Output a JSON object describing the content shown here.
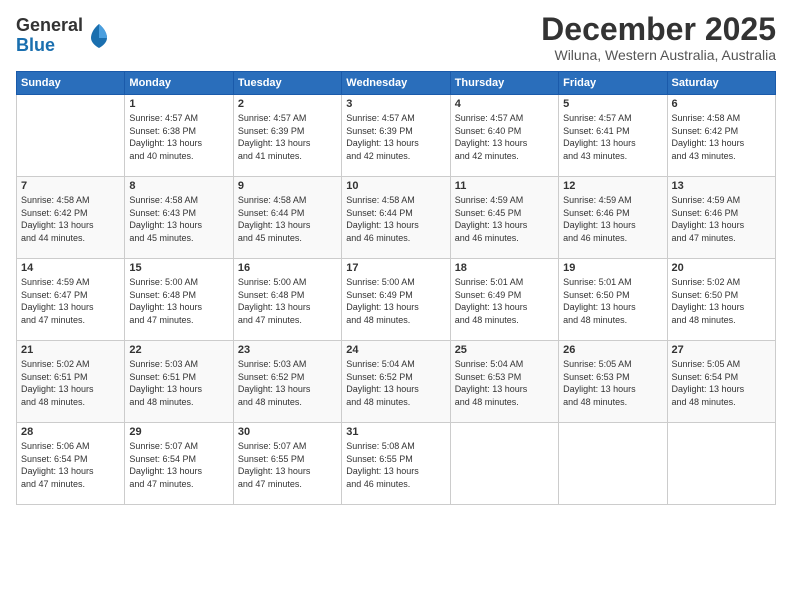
{
  "logo": {
    "general": "General",
    "blue": "Blue"
  },
  "title": "December 2025",
  "subtitle": "Wiluna, Western Australia, Australia",
  "days_header": [
    "Sunday",
    "Monday",
    "Tuesday",
    "Wednesday",
    "Thursday",
    "Friday",
    "Saturday"
  ],
  "weeks": [
    [
      {
        "num": "",
        "info": ""
      },
      {
        "num": "1",
        "info": "Sunrise: 4:57 AM\nSunset: 6:38 PM\nDaylight: 13 hours\nand 40 minutes."
      },
      {
        "num": "2",
        "info": "Sunrise: 4:57 AM\nSunset: 6:39 PM\nDaylight: 13 hours\nand 41 minutes."
      },
      {
        "num": "3",
        "info": "Sunrise: 4:57 AM\nSunset: 6:39 PM\nDaylight: 13 hours\nand 42 minutes."
      },
      {
        "num": "4",
        "info": "Sunrise: 4:57 AM\nSunset: 6:40 PM\nDaylight: 13 hours\nand 42 minutes."
      },
      {
        "num": "5",
        "info": "Sunrise: 4:57 AM\nSunset: 6:41 PM\nDaylight: 13 hours\nand 43 minutes."
      },
      {
        "num": "6",
        "info": "Sunrise: 4:58 AM\nSunset: 6:42 PM\nDaylight: 13 hours\nand 43 minutes."
      }
    ],
    [
      {
        "num": "7",
        "info": "Sunrise: 4:58 AM\nSunset: 6:42 PM\nDaylight: 13 hours\nand 44 minutes."
      },
      {
        "num": "8",
        "info": "Sunrise: 4:58 AM\nSunset: 6:43 PM\nDaylight: 13 hours\nand 45 minutes."
      },
      {
        "num": "9",
        "info": "Sunrise: 4:58 AM\nSunset: 6:44 PM\nDaylight: 13 hours\nand 45 minutes."
      },
      {
        "num": "10",
        "info": "Sunrise: 4:58 AM\nSunset: 6:44 PM\nDaylight: 13 hours\nand 46 minutes."
      },
      {
        "num": "11",
        "info": "Sunrise: 4:59 AM\nSunset: 6:45 PM\nDaylight: 13 hours\nand 46 minutes."
      },
      {
        "num": "12",
        "info": "Sunrise: 4:59 AM\nSunset: 6:46 PM\nDaylight: 13 hours\nand 46 minutes."
      },
      {
        "num": "13",
        "info": "Sunrise: 4:59 AM\nSunset: 6:46 PM\nDaylight: 13 hours\nand 47 minutes."
      }
    ],
    [
      {
        "num": "14",
        "info": "Sunrise: 4:59 AM\nSunset: 6:47 PM\nDaylight: 13 hours\nand 47 minutes."
      },
      {
        "num": "15",
        "info": "Sunrise: 5:00 AM\nSunset: 6:48 PM\nDaylight: 13 hours\nand 47 minutes."
      },
      {
        "num": "16",
        "info": "Sunrise: 5:00 AM\nSunset: 6:48 PM\nDaylight: 13 hours\nand 47 minutes."
      },
      {
        "num": "17",
        "info": "Sunrise: 5:00 AM\nSunset: 6:49 PM\nDaylight: 13 hours\nand 48 minutes."
      },
      {
        "num": "18",
        "info": "Sunrise: 5:01 AM\nSunset: 6:49 PM\nDaylight: 13 hours\nand 48 minutes."
      },
      {
        "num": "19",
        "info": "Sunrise: 5:01 AM\nSunset: 6:50 PM\nDaylight: 13 hours\nand 48 minutes."
      },
      {
        "num": "20",
        "info": "Sunrise: 5:02 AM\nSunset: 6:50 PM\nDaylight: 13 hours\nand 48 minutes."
      }
    ],
    [
      {
        "num": "21",
        "info": "Sunrise: 5:02 AM\nSunset: 6:51 PM\nDaylight: 13 hours\nand 48 minutes."
      },
      {
        "num": "22",
        "info": "Sunrise: 5:03 AM\nSunset: 6:51 PM\nDaylight: 13 hours\nand 48 minutes."
      },
      {
        "num": "23",
        "info": "Sunrise: 5:03 AM\nSunset: 6:52 PM\nDaylight: 13 hours\nand 48 minutes."
      },
      {
        "num": "24",
        "info": "Sunrise: 5:04 AM\nSunset: 6:52 PM\nDaylight: 13 hours\nand 48 minutes."
      },
      {
        "num": "25",
        "info": "Sunrise: 5:04 AM\nSunset: 6:53 PM\nDaylight: 13 hours\nand 48 minutes."
      },
      {
        "num": "26",
        "info": "Sunrise: 5:05 AM\nSunset: 6:53 PM\nDaylight: 13 hours\nand 48 minutes."
      },
      {
        "num": "27",
        "info": "Sunrise: 5:05 AM\nSunset: 6:54 PM\nDaylight: 13 hours\nand 48 minutes."
      }
    ],
    [
      {
        "num": "28",
        "info": "Sunrise: 5:06 AM\nSunset: 6:54 PM\nDaylight: 13 hours\nand 47 minutes."
      },
      {
        "num": "29",
        "info": "Sunrise: 5:07 AM\nSunset: 6:54 PM\nDaylight: 13 hours\nand 47 minutes."
      },
      {
        "num": "30",
        "info": "Sunrise: 5:07 AM\nSunset: 6:55 PM\nDaylight: 13 hours\nand 47 minutes."
      },
      {
        "num": "31",
        "info": "Sunrise: 5:08 AM\nSunset: 6:55 PM\nDaylight: 13 hours\nand 46 minutes."
      },
      {
        "num": "",
        "info": ""
      },
      {
        "num": "",
        "info": ""
      },
      {
        "num": "",
        "info": ""
      }
    ]
  ]
}
